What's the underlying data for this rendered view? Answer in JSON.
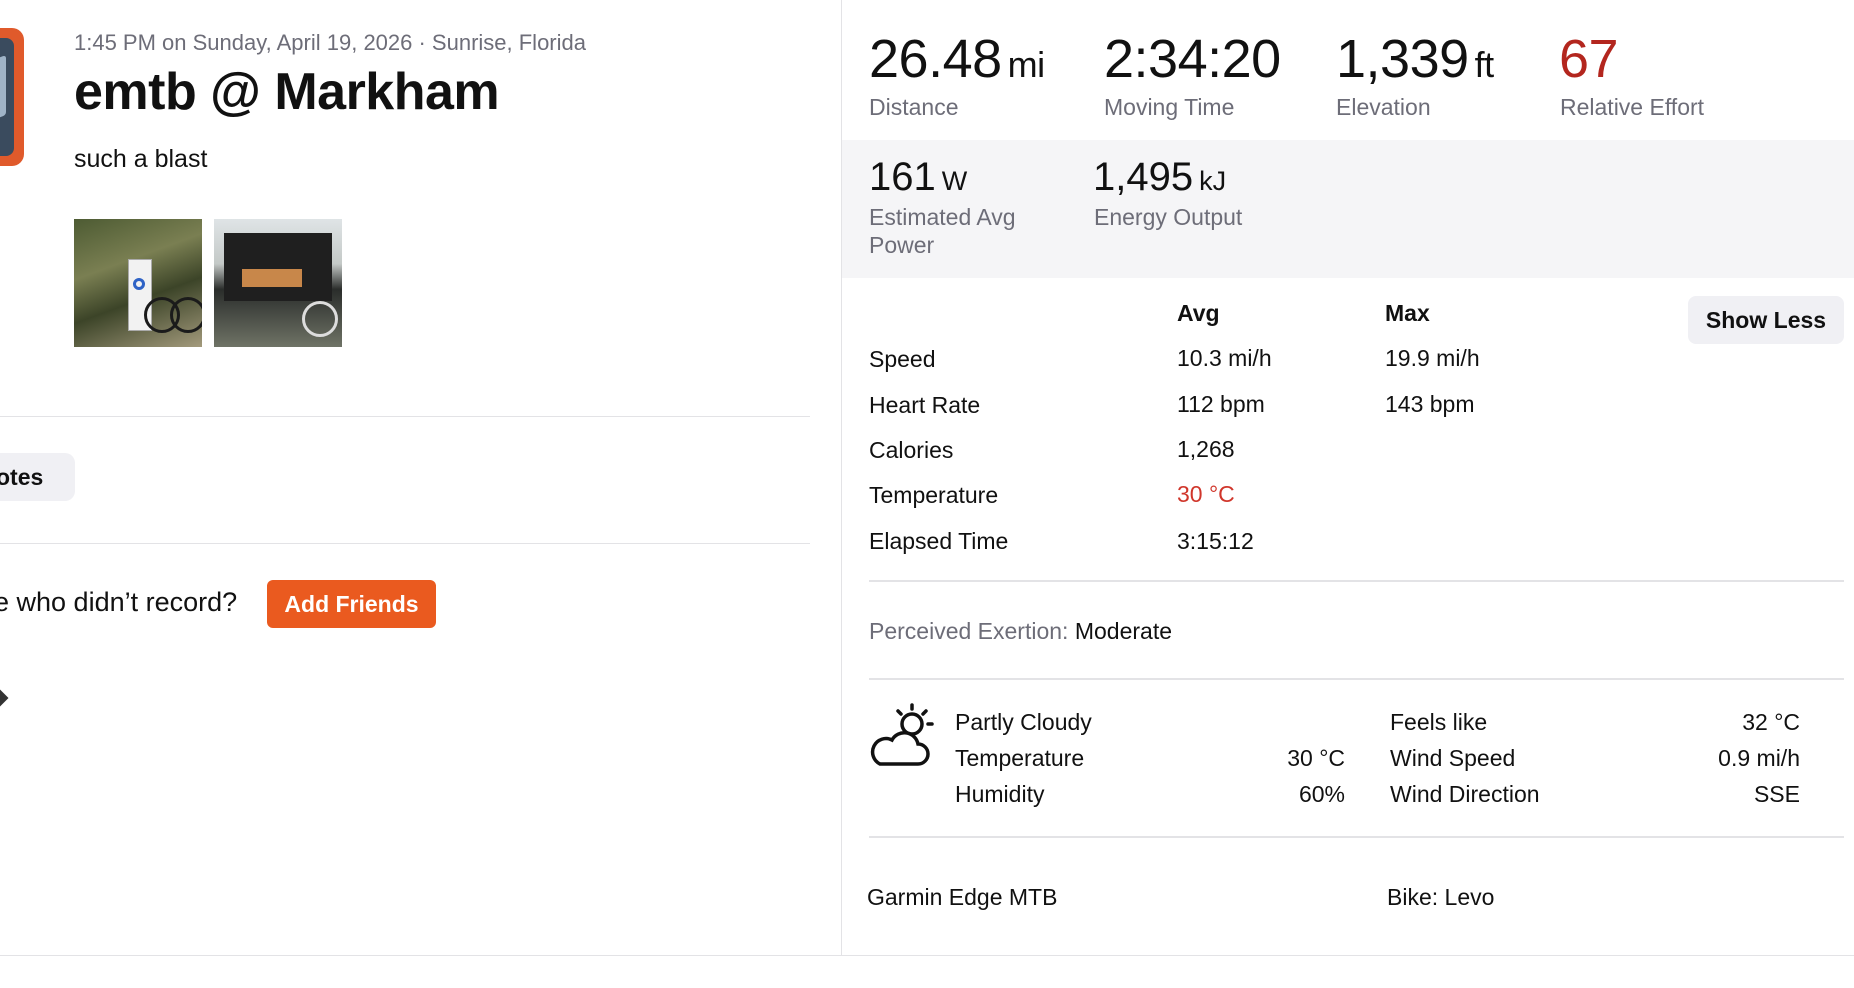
{
  "activity": {
    "meta": "1:45 PM on Sunday, April 19, 2026 · Sunrise, Florida",
    "title": "emtb @ Markham",
    "description": "such a blast"
  },
  "left_actions": {
    "notes_label": "otes",
    "record_question": "e who didn’t record?",
    "add_friends_label": "Add Friends"
  },
  "primary_stats": [
    {
      "value": "26.48",
      "unit": "mi",
      "label": "Distance"
    },
    {
      "value": "2:34:20",
      "unit": "",
      "label": "Moving Time"
    },
    {
      "value": "1,339",
      "unit": "ft",
      "label": "Elevation"
    },
    {
      "value": "67",
      "unit": "",
      "label": "Relative Effort"
    }
  ],
  "secondary_stats": [
    {
      "value": "161",
      "unit": "W",
      "label_line1": "Estimated Avg",
      "label_line2": "Power"
    },
    {
      "value": "1,495",
      "unit": "kJ",
      "label_line1": "Energy Output",
      "label_line2": ""
    }
  ],
  "details_table": {
    "headers": {
      "avg": "Avg",
      "max": "Max"
    },
    "show_less_label": "Show Less",
    "rows": [
      {
        "label": "Speed",
        "avg": "10.3 mi/h",
        "max": "19.9 mi/h"
      },
      {
        "label": "Heart Rate",
        "avg": "112 bpm",
        "max": "143 bpm"
      },
      {
        "label": "Calories",
        "avg": "1,268",
        "max": ""
      },
      {
        "label": "Temperature",
        "avg": "30 °C",
        "max": ""
      },
      {
        "label": "Elapsed Time",
        "avg": "3:15:12",
        "max": ""
      }
    ]
  },
  "perceived_exertion": {
    "label": "Perceived Exertion:",
    "value": "Moderate"
  },
  "weather": {
    "icon": "partly-cloudy-icon",
    "condition": "Partly Cloudy",
    "left": [
      {
        "label": "Temperature",
        "value": "30 °C"
      },
      {
        "label": "Humidity",
        "value": "60%"
      }
    ],
    "right": [
      {
        "label": "Feels like",
        "value": "32 °C"
      },
      {
        "label": "Wind Speed",
        "value": "0.9 mi/h"
      },
      {
        "label": "Wind Direction",
        "value": "SSE"
      }
    ]
  },
  "gear": {
    "device": "Garmin Edge MTB",
    "bike": "Bike: Levo"
  },
  "colors": {
    "accent": "#ea5a1f",
    "relative_effort": "#b3261e",
    "temperature": "#d0362b"
  }
}
